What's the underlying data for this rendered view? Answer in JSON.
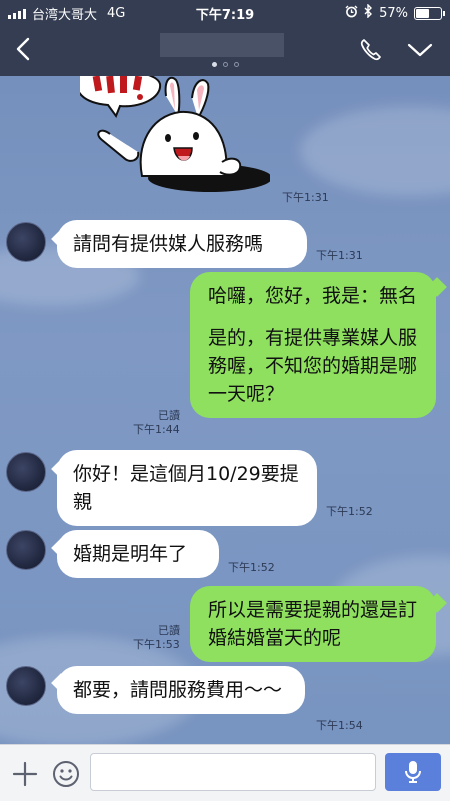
{
  "status": {
    "carrier": "台湾大哥大",
    "network": "4G",
    "time": "下午7:19",
    "battery": "57%",
    "battery_level": 0.57
  },
  "header": {
    "dots_count": 3,
    "active_dot": 0
  },
  "messages": [
    {
      "side": "out",
      "type": "sticker",
      "time": "下午1:31"
    },
    {
      "side": "in",
      "text": [
        "請問有提供媒人服務嗎"
      ],
      "time": "下午1:31"
    },
    {
      "side": "out",
      "paragraphs": [
        "哈囉，您好，我是：無名",
        "是的，有提供專業媒人服務喔，不知您的婚期是哪一天呢？"
      ],
      "read": "已讀",
      "time": "下午1:44"
    },
    {
      "side": "in",
      "text": [
        "你好！是這個月10/29要提親"
      ],
      "time": "下午1:52"
    },
    {
      "side": "in",
      "text": [
        "婚期是明年了"
      ],
      "time": "下午1:52"
    },
    {
      "side": "out",
      "text": [
        "所以是需要提親的還是訂婚結婚當天的呢"
      ],
      "read": "已讀",
      "time": "下午1:53"
    },
    {
      "side": "in",
      "text": [
        "都要，請問服務費用～～"
      ],
      "time": "下午1:54"
    }
  ],
  "input": {
    "placeholder": ""
  },
  "colors": {
    "bar": "#353d52",
    "chat_bg": "#7d97c2",
    "bubble_out": "#8ee05e",
    "bubble_in": "#ffffff",
    "mic_button": "#5a80db"
  },
  "icons": [
    "signal-icon",
    "bluetooth-icon",
    "alarm-icon",
    "battery-icon",
    "back-icon",
    "phone-icon",
    "chevron-down-icon",
    "plus-icon",
    "emoji-icon",
    "microphone-icon"
  ]
}
